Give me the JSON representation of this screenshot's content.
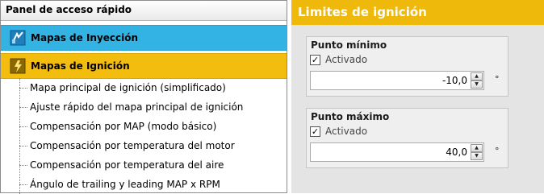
{
  "sidebar": {
    "header": "Panel de acceso rápido",
    "categories": [
      {
        "label": "Mapas de Inyección",
        "icon": "injection-icon",
        "color": "#33b3e4"
      },
      {
        "label": "Mapas de Ignición",
        "icon": "ignition-icon",
        "color": "#f2bd0f"
      }
    ],
    "items": [
      {
        "label": "Mapa principal de ignición (simplificado)"
      },
      {
        "label": "Ajuste rápido del mapa principal de ignición"
      },
      {
        "label": "Compensación por MAP (modo básico)"
      },
      {
        "label": "Compensación por temperatura del motor"
      },
      {
        "label": "Compensación por temperatura del aire"
      },
      {
        "label": "Ángulo de trailing y leading MAP x RPM"
      }
    ]
  },
  "panel": {
    "title": "Limites de ignición",
    "accent": "#efb90b",
    "groups": [
      {
        "title": "Punto mínimo",
        "checkbox_label": "Activado",
        "checked": true,
        "value": "-10,0",
        "unit": "°"
      },
      {
        "title": "Punto máximo",
        "checkbox_label": "Activado",
        "checked": true,
        "value": "40,0",
        "unit": "°"
      }
    ]
  }
}
